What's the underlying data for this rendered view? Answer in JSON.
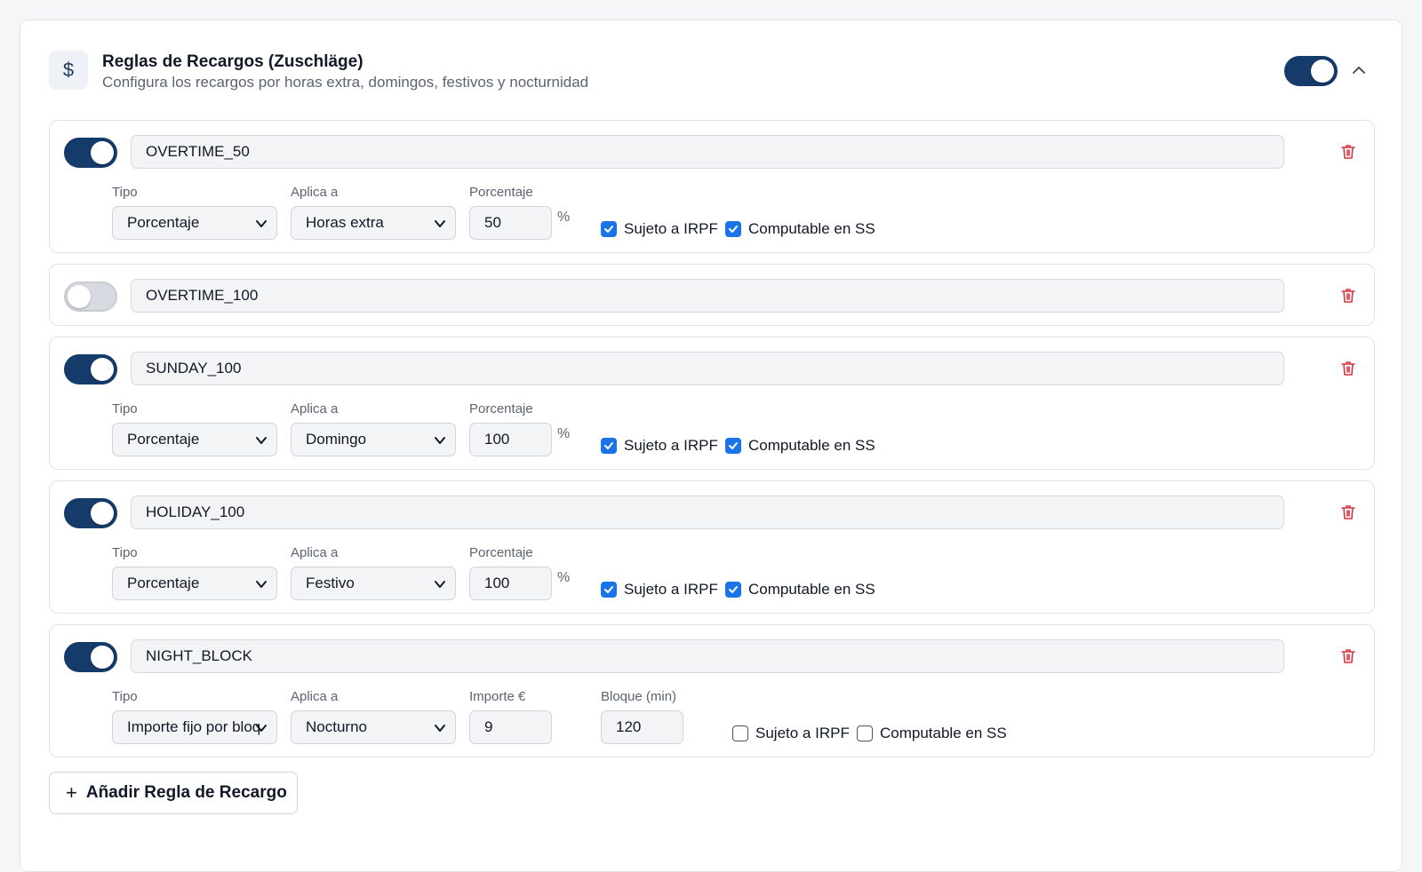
{
  "header": {
    "icon": "dollar-icon",
    "title": "Reglas de Recargos (Zuschläge)",
    "subtitle": "Configura los recargos por horas extra, domingos, festivos y nocturnidad",
    "enabled": true
  },
  "labels": {
    "tipo": "Tipo",
    "aplica": "Aplica a",
    "porcentaje": "Porcentaje",
    "importe": "Importe €",
    "bloque": "Bloque (min)",
    "pct_unit": "%",
    "irpf": "Sujeto a IRPF",
    "ss": "Computable en SS"
  },
  "rules": [
    {
      "name": "OVERTIME_50",
      "enabled": true,
      "tipo": "Porcentaje",
      "aplica": "Horas extra",
      "porcentaje": "50",
      "irpf": true,
      "ss": true
    },
    {
      "name": "OVERTIME_100",
      "enabled": false
    },
    {
      "name": "SUNDAY_100",
      "enabled": true,
      "tipo": "Porcentaje",
      "aplica": "Domingo",
      "porcentaje": "100",
      "irpf": true,
      "ss": true
    },
    {
      "name": "HOLIDAY_100",
      "enabled": true,
      "tipo": "Porcentaje",
      "aplica": "Festivo",
      "porcentaje": "100",
      "irpf": true,
      "ss": true
    },
    {
      "name": "NIGHT_BLOCK",
      "enabled": true,
      "tipo": "Importe fijo por bloq",
      "aplica": "Nocturno",
      "importe": "9",
      "bloque": "120",
      "irpf": false,
      "ss": false
    }
  ],
  "add_button": {
    "icon": "plus-icon",
    "label": "Añadir Regla de Recargo"
  },
  "colors": {
    "accent": "#153b6b",
    "checkbox": "#1a73e8",
    "danger": "#d9363e"
  }
}
